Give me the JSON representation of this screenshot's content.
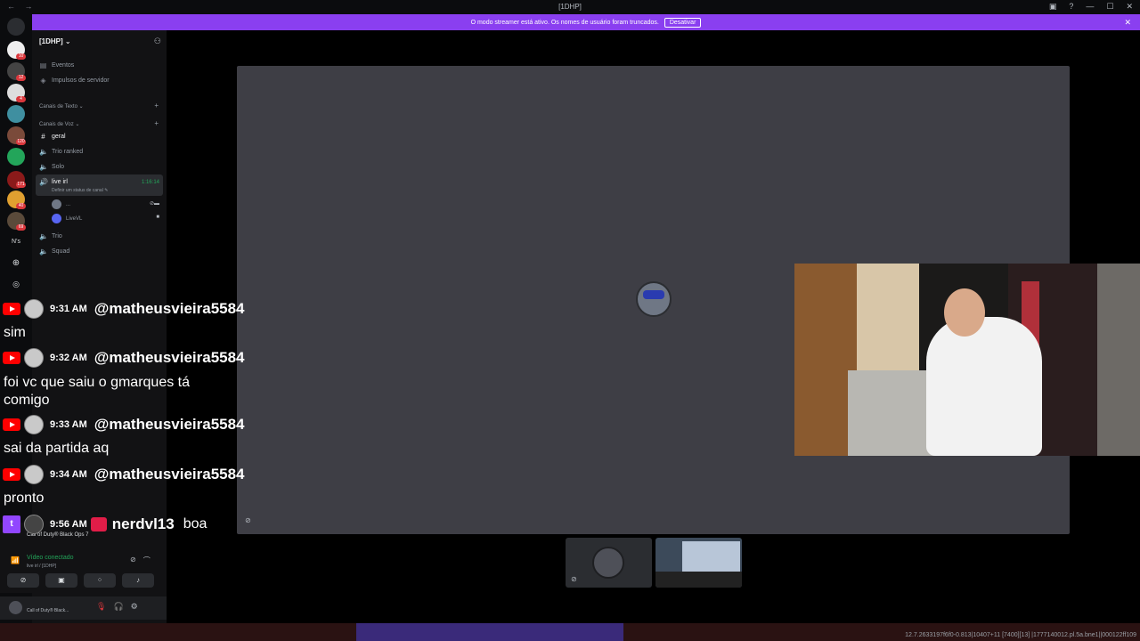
{
  "titlebar": {
    "title": "[1DHP]"
  },
  "banner": {
    "text": "O modo streamer está ativo. Os nomes de usuário foram truncados.",
    "button_label": "Desativar"
  },
  "rail": {
    "badges": [
      "10",
      "12",
      "4",
      "120",
      "171",
      "40",
      "69"
    ],
    "folder_label": "N's"
  },
  "sidebar": {
    "server_name": "[1DHP]",
    "items": [
      {
        "label": "Eventos",
        "icon": "calendar-icon"
      },
      {
        "label": "Impulsos de servidor",
        "icon": "boost-icon"
      }
    ],
    "categories": {
      "text": "Canais de Texto",
      "voice": "Canais de Voz"
    },
    "channels": [
      {
        "label": "geral",
        "icon": "hash-icon"
      },
      {
        "label": "Trio ranked",
        "icon": "speaker-icon"
      },
      {
        "label": "Solo",
        "icon": "speaker-icon"
      },
      {
        "label": "live irl",
        "icon": "speaker-icon"
      },
      {
        "label": "Trio",
        "icon": "speaker-icon"
      },
      {
        "label": "Squad",
        "icon": "speaker-icon"
      }
    ],
    "active_timer": "1:16:14",
    "active_status": "Definir um status de canal",
    "voice_users": [
      {
        "name": "..."
      },
      {
        "name": "LiveVL"
      }
    ]
  },
  "voice_panel": {
    "game": "Call of Duty® Black Ops 7",
    "status": "Vídeo conectado",
    "sub": "live irl / [1DHP]"
  },
  "userbar": {
    "text": "Call of Duty® Black..."
  },
  "chat": [
    {
      "time": "9:31 AM",
      "user": "@matheusvieira5584",
      "text": "sim"
    },
    {
      "time": "9:32 AM",
      "user": "@matheusvieira5584",
      "text": "foi vc que saiu o gmarques tá comigo"
    },
    {
      "time": "9:33 AM",
      "user": "@matheusvieira5584",
      "text": "sai da partida aq"
    },
    {
      "time": "9:34 AM",
      "user": "@matheusvieira5584",
      "text": "pronto"
    },
    {
      "time": "9:56 AM",
      "user": "nerdvl13",
      "text": "boa"
    }
  ],
  "bottom_code": "12.7.2633197f6f0-0.813|10407+11 [7400][13] |1777140012.pl.5a.bne1||000122ff109",
  "colors": {
    "accent": "#5865f2",
    "banner": "#8a3ff0",
    "connected": "#23a55a",
    "youtube": "#ff0000",
    "twitch": "#9146ff"
  }
}
